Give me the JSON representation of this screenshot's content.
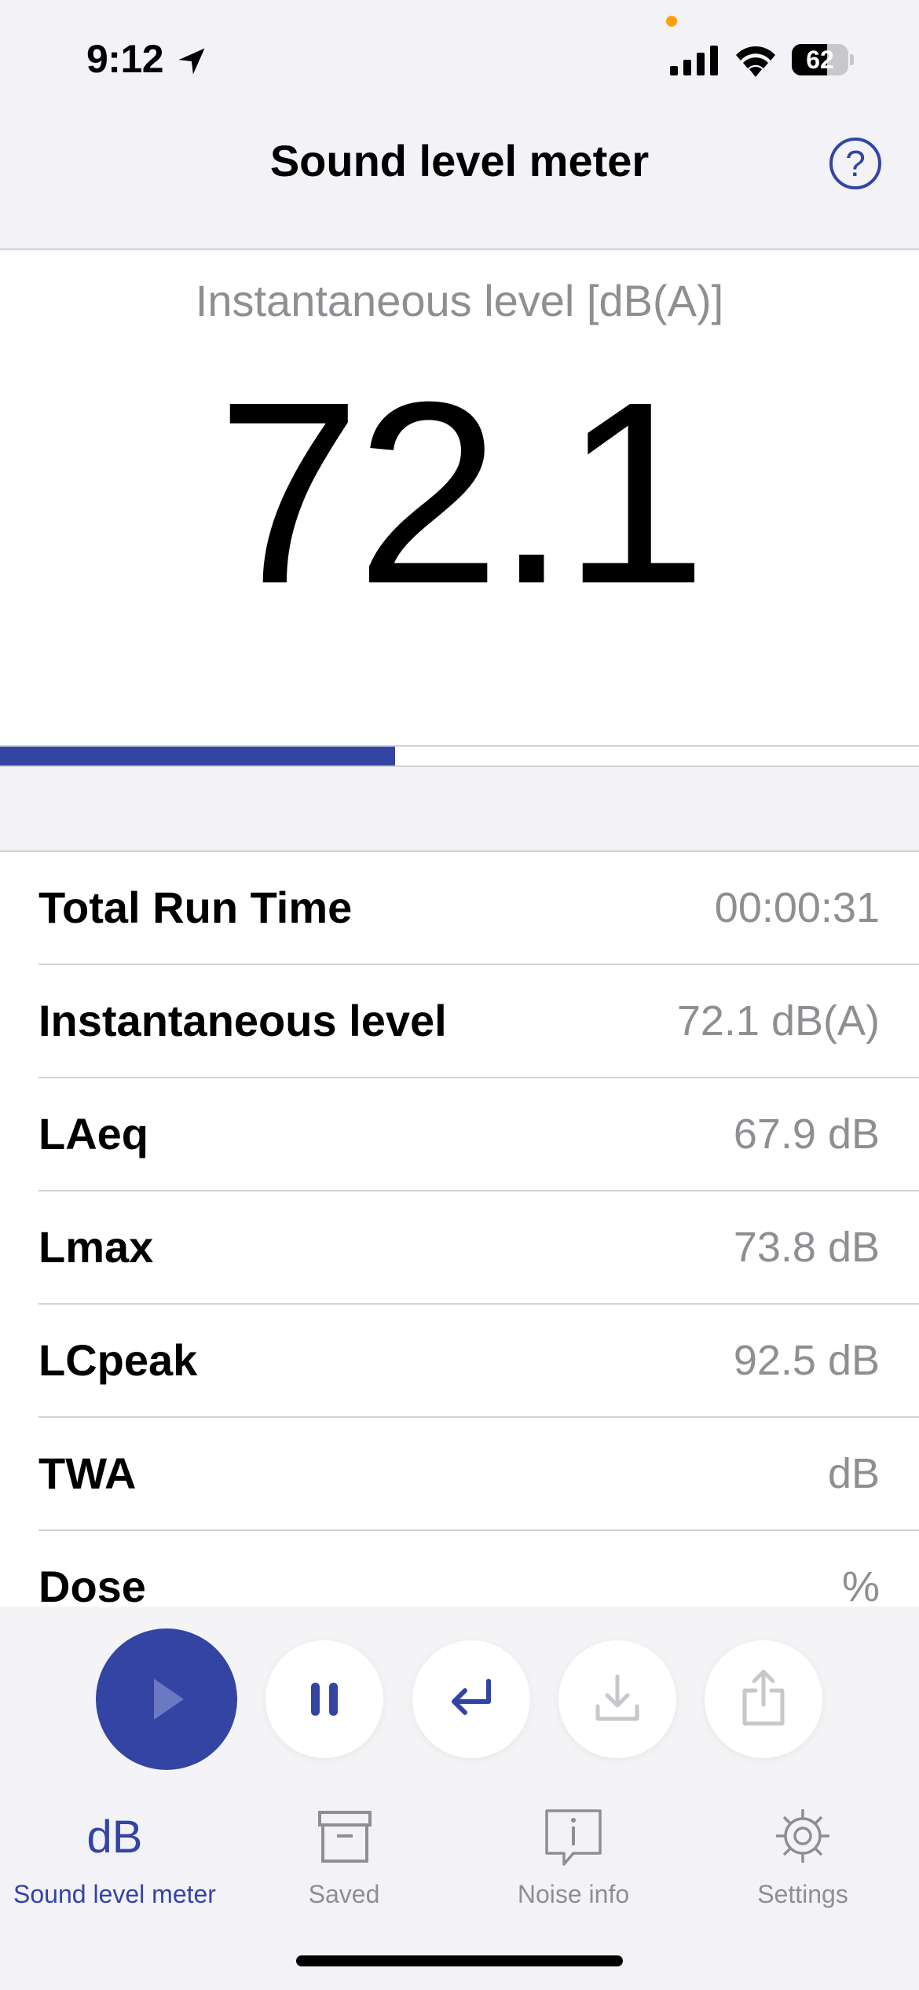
{
  "status_bar": {
    "time": "9:12",
    "battery": "62",
    "battery_fraction": 0.62,
    "icons": [
      "location-arrow-icon",
      "signal-icon",
      "wifi-icon",
      "battery-icon"
    ]
  },
  "nav": {
    "title": "Sound level meter",
    "help_icon": "question-circle-icon",
    "help_glyph": "?"
  },
  "meter": {
    "label": "Instantaneous level [dB(A)]",
    "value": "72.1",
    "level_fraction": 0.43
  },
  "metrics": [
    {
      "label": "Total Run Time",
      "value": "00:00:31"
    },
    {
      "label": "Instantaneous level",
      "value": "72.1 dB(A)"
    },
    {
      "label": "LAeq",
      "value": "67.9 dB"
    },
    {
      "label": "Lmax",
      "value": "73.8 dB"
    },
    {
      "label": "LCpeak",
      "value": "92.5 dB"
    },
    {
      "label": "TWA",
      "value": "dB"
    },
    {
      "label": "Dose",
      "value": "%"
    }
  ],
  "controls": [
    {
      "name": "play",
      "icon": "play-icon",
      "enabled": false
    },
    {
      "name": "pause",
      "icon": "pause-icon",
      "enabled": true
    },
    {
      "name": "reset",
      "icon": "return-arrow-icon",
      "enabled": true
    },
    {
      "name": "save",
      "icon": "download-icon",
      "enabled": false
    },
    {
      "name": "share",
      "icon": "share-icon",
      "enabled": false
    }
  ],
  "tabs": [
    {
      "label": "Sound level meter",
      "icon": "db-text-icon",
      "glyph": "dB",
      "active": true
    },
    {
      "label": "Saved",
      "icon": "archive-box-icon",
      "active": false
    },
    {
      "label": "Noise info",
      "icon": "info-bubble-icon",
      "active": false
    },
    {
      "label": "Settings",
      "icon": "gear-icon",
      "active": false
    }
  ],
  "colors": {
    "accent": "#3344a3",
    "secondary_text": "#8e8e93",
    "background": "#f2f2f7",
    "mic_indicator": "#ff9f0a"
  }
}
